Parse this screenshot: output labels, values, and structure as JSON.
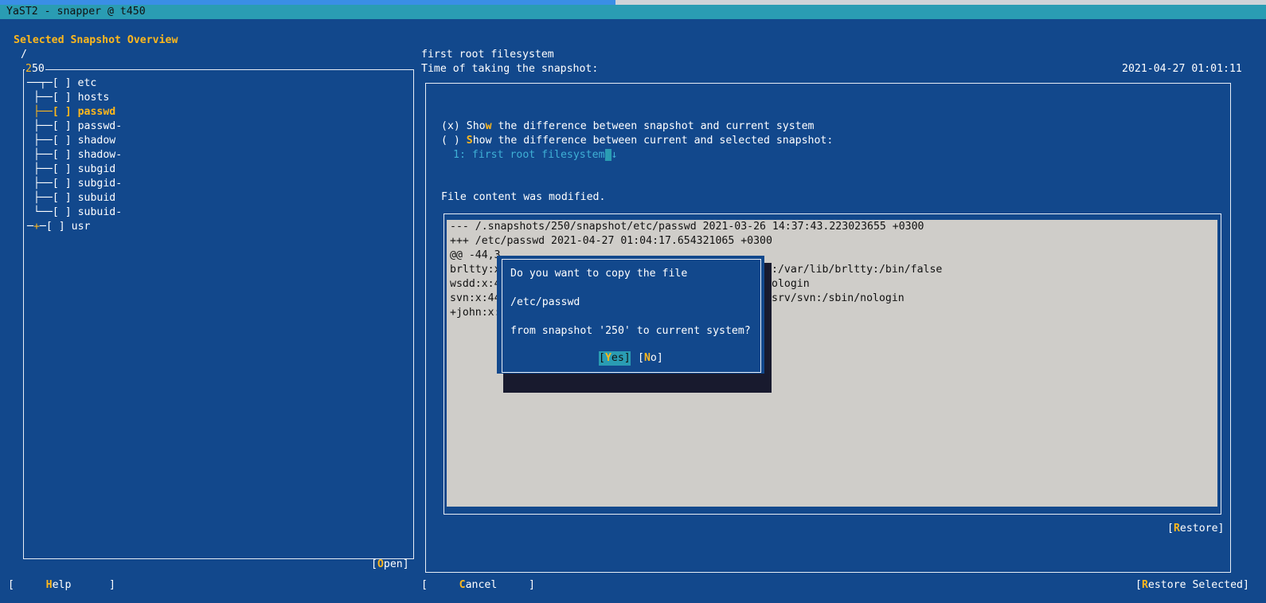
{
  "window": {
    "title": "YaST2 - snapper @ t450"
  },
  "heading": "Selected Snapshot Overview",
  "path": "/",
  "tree": {
    "frame_label": "250",
    "root_item": {
      "check": "[ ]",
      "label": "etc"
    },
    "children": [
      {
        "check": "[ ]",
        "label": "hosts"
      },
      {
        "check": "[ ]",
        "label": "passwd"
      },
      {
        "check": "[ ]",
        "label": "passwd-"
      },
      {
        "check": "[ ]",
        "label": "shadow"
      },
      {
        "check": "[ ]",
        "label": "shadow-"
      },
      {
        "check": "[ ]",
        "label": "subgid"
      },
      {
        "check": "[ ]",
        "label": "subgid-"
      },
      {
        "check": "[ ]",
        "label": "subuid"
      },
      {
        "check": "[ ]",
        "label": "subuid-"
      }
    ],
    "second_root": {
      "check": "[ ]",
      "label": "usr"
    },
    "selected": "passwd"
  },
  "open_button": {
    "pre": "[",
    "hot": "O",
    "rest": "pen]"
  },
  "snapshot": {
    "description": "first root filesystem",
    "time_label": "Time of taking the snapshot:",
    "time_value": "2021-04-27 01:01:11"
  },
  "radio": {
    "opt1": {
      "mark": "(x)",
      "pre": "Sho",
      "hot": "w",
      "rest": " the difference between snapshot and current system"
    },
    "opt2": {
      "mark": "( )",
      "hot": "S",
      "rest": "how the difference between current and selected snapshot:"
    },
    "combo_value": "1: first root filesystem",
    "combo_arrow": "↓"
  },
  "status": "File content was modified.",
  "diff_lines": [
    "--- /.snapshots/250/snapshot/etc/passwd 2021-03-26 14:37:43.223023655 +0300",
    "+++ /etc/passwd 2021-04-27 01:04:17.654321065 +0300",
    "@@ -44,3",
    "brltty:x",
    "wsdd:x:4",
    "svn:x:44",
    "+john:x:"
  ],
  "diff_tails": [
    ":/var/lib/brltty:/bin/false",
    "ologin",
    "srv/svn:/sbin/nologin"
  ],
  "restore_button": {
    "pre": "[",
    "hot": "R",
    "rest": "estore]"
  },
  "dialog": {
    "line1": "Do you want to copy the file",
    "line2": "/etc/passwd",
    "line3": "from snapshot '250' to current system?",
    "yes": {
      "pre": "[",
      "hot": "Y",
      "rest": "es]"
    },
    "no": {
      "pre": "[",
      "hot": "N",
      "rest": "o]"
    }
  },
  "footer": {
    "help": {
      "pre": "[     ",
      "hot": "H",
      "rest": "elp      ]"
    },
    "cancel": {
      "pre": "[     ",
      "hot": "C",
      "rest": "ancel     ]"
    },
    "restore_selected": {
      "pre": "[",
      "hot": "R",
      "rest": "estore Selected]"
    }
  },
  "colors": {
    "background": "#12488c",
    "title_bar": "#2a9cb3",
    "hotkey": "#ffb81c",
    "diff_bg": "#cfcdc9",
    "focus": "#2a9cb3"
  }
}
